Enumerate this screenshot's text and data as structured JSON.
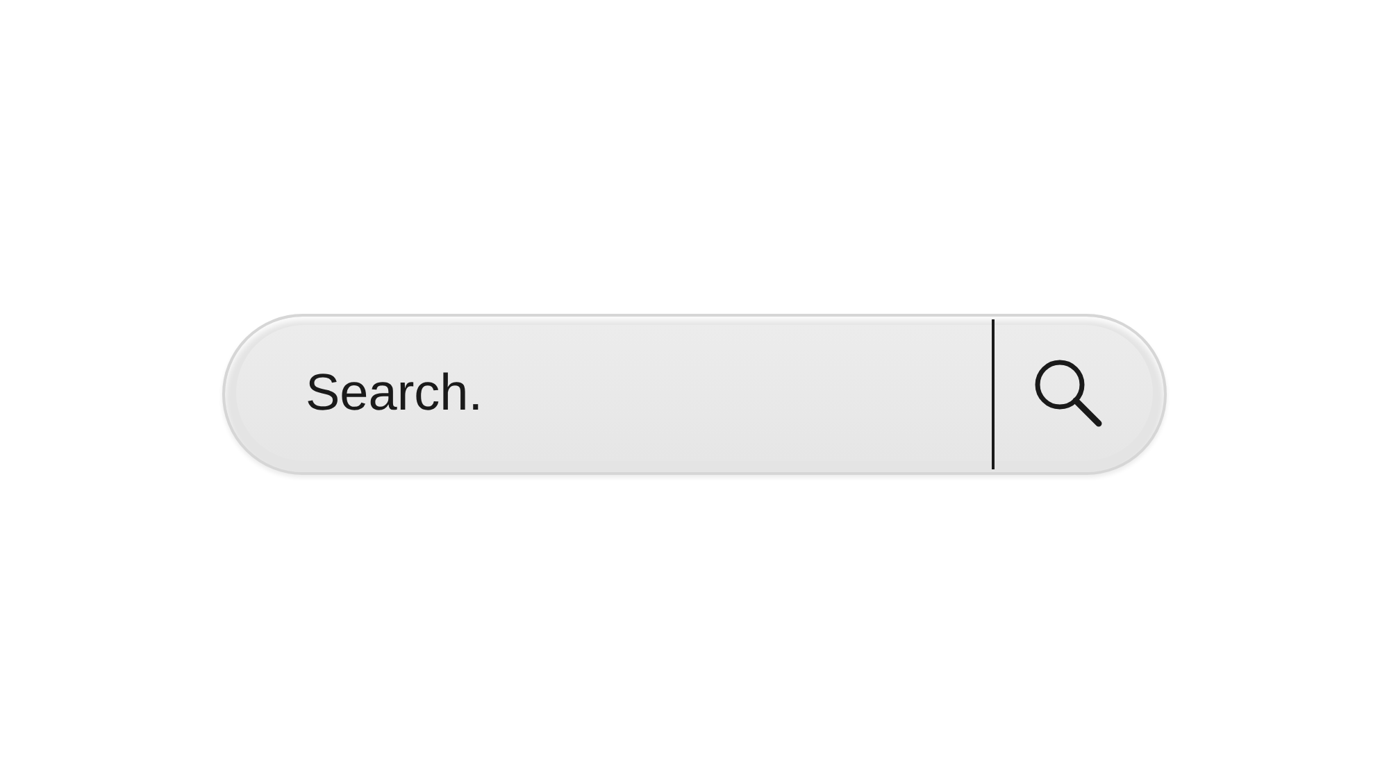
{
  "search": {
    "value": "Search."
  }
}
